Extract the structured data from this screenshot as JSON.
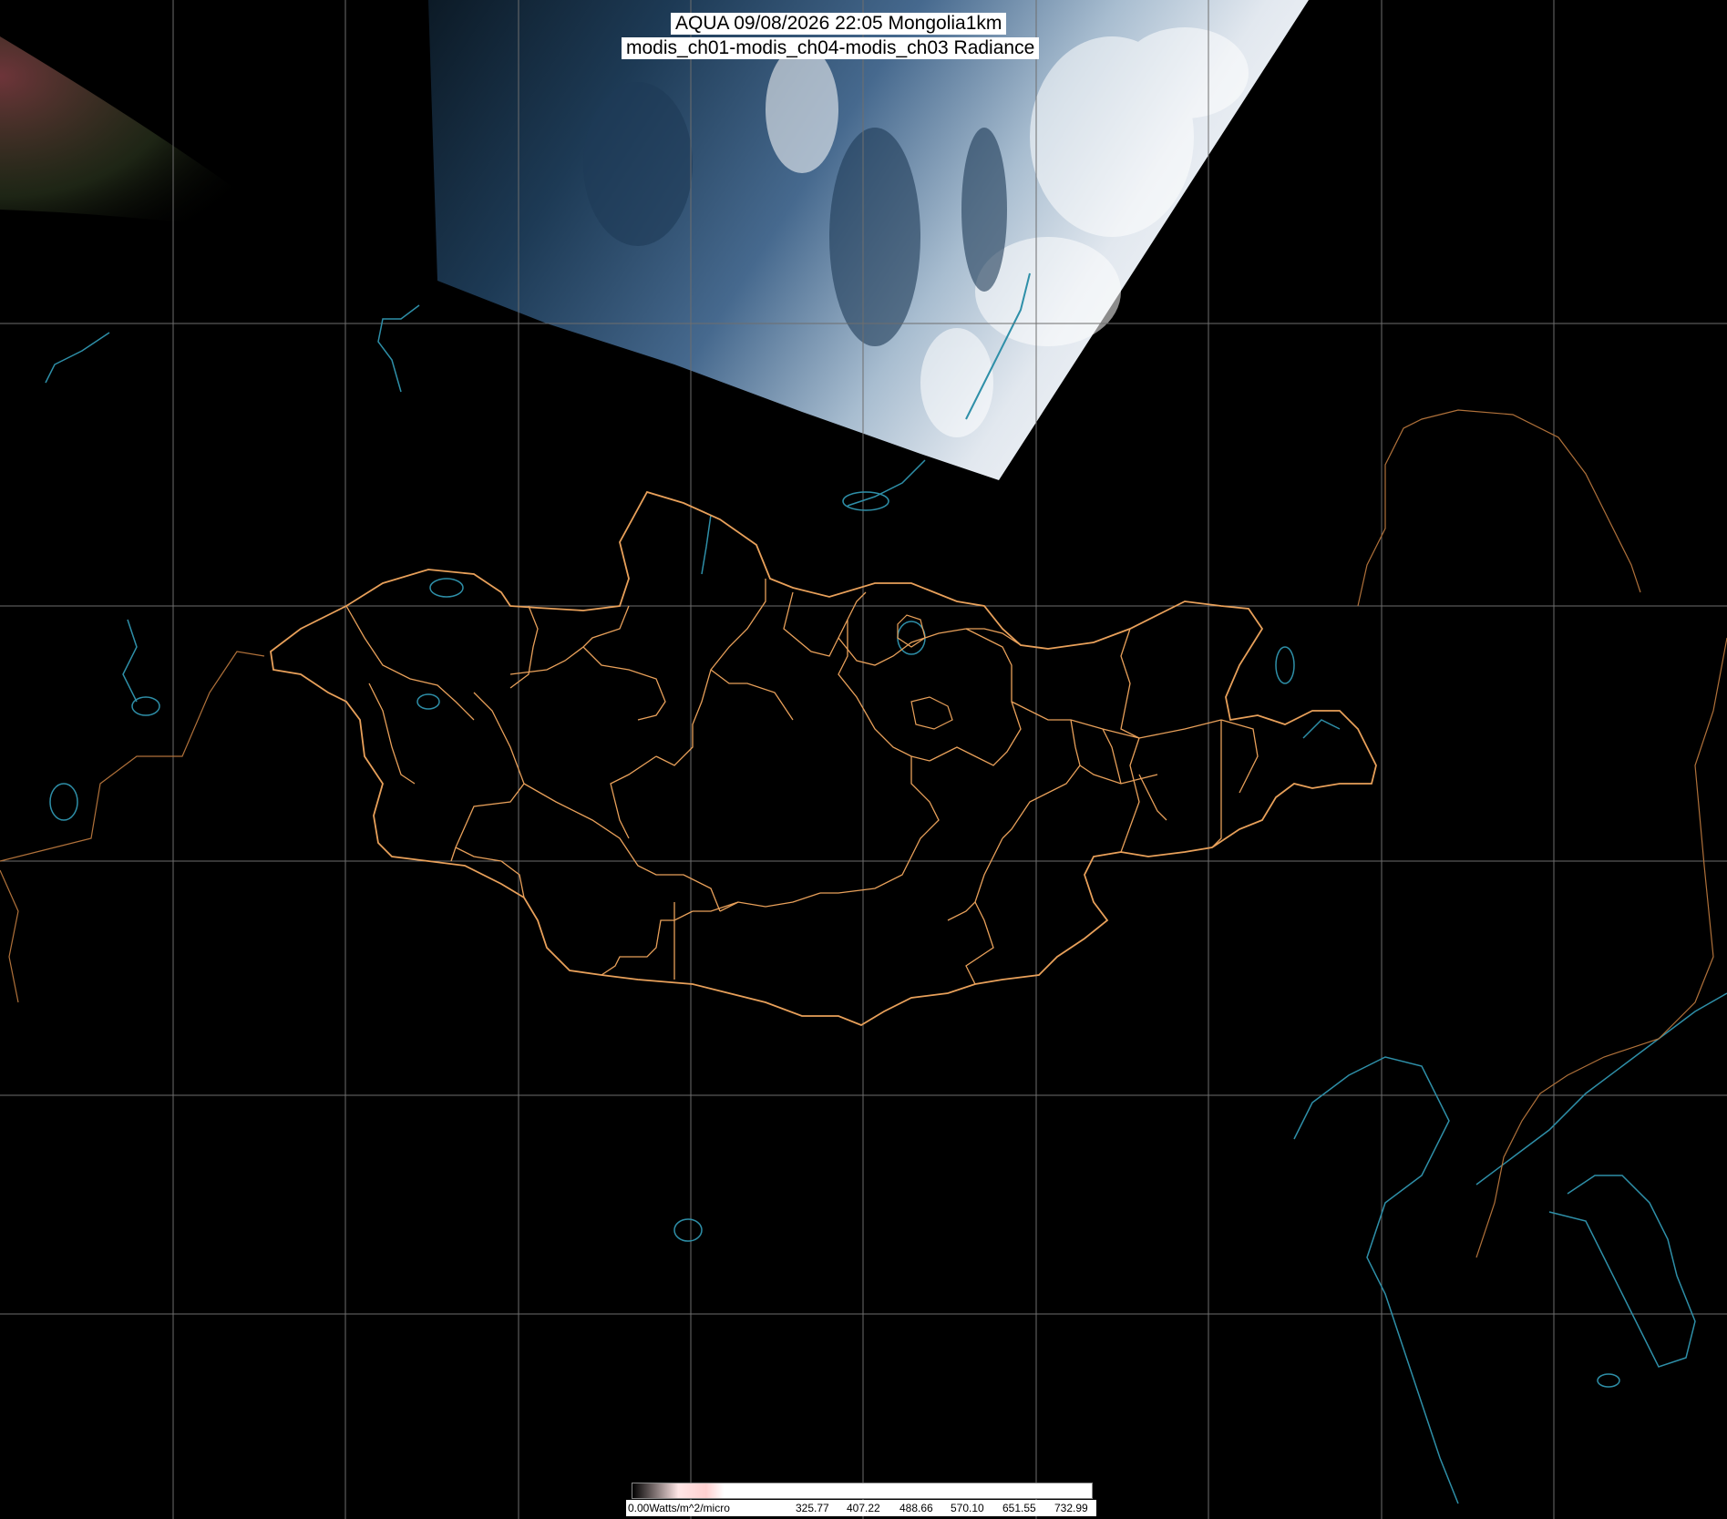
{
  "title": {
    "line1": "AQUA 09/08/2026 22:05 Mongolia1km",
    "line2": "modis_ch01-modis_ch04-modis_ch03 Radiance"
  },
  "colorbar": {
    "unit_label": "0.00Watts/m^2/micro",
    "ticks": [
      "325.77",
      "407.22",
      "488.66",
      "570.10",
      "651.55",
      "732.99"
    ]
  },
  "colors": {
    "background": "#000000",
    "graticule": "#6e6e6e",
    "country_border": "#e8a05a",
    "province_border": "#e8a05a",
    "coastline": "#2e8fa8",
    "cloud_white": "#eef2f6",
    "surface_blue": "#3a5f85"
  }
}
